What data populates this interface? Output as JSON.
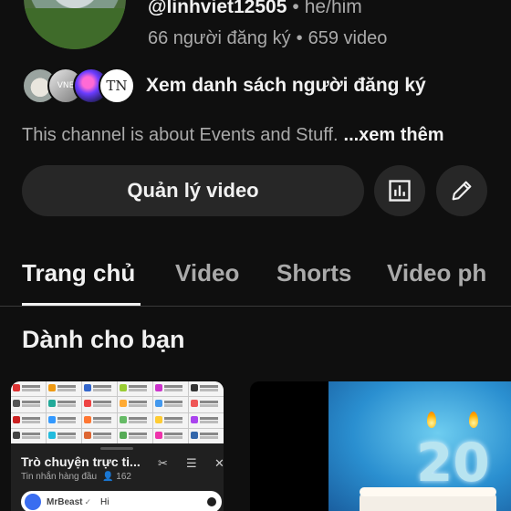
{
  "channel": {
    "handle": "@linhviet12505",
    "pronouns": "he/him",
    "subscribers": "66 người đăng ký",
    "videos": "659 video",
    "subscribers_link": "Xem danh sách người đăng ký",
    "subscriber_avatar_2_text": "VNE",
    "subscriber_avatar_4_text": "TN",
    "description": "This channel is about Events and Stuff.",
    "description_more": "...xem thêm"
  },
  "actions": {
    "manage_label": "Quản lý video",
    "stats_icon": "bar-chart-icon",
    "edit_icon": "pencil-icon"
  },
  "tabs": [
    {
      "label": "Trang chủ",
      "active": true
    },
    {
      "label": "Video",
      "active": false
    },
    {
      "label": "Shorts",
      "active": false
    },
    {
      "label": "Video ph",
      "active": false
    }
  ],
  "section": {
    "title": "Dành cho bạn"
  },
  "live_chat_thumb": {
    "title": "Trò chuyện trực ti...",
    "subtitle": "Tin nhắn hàng đầu",
    "viewer_count": "162",
    "message_author": "MrBeast",
    "message_text": "Hi"
  },
  "birthday_thumb": {
    "number": "20"
  },
  "colors": {
    "background": "#0f0f0f",
    "button_bg": "#272727",
    "text_primary": "#f1f1f1",
    "text_secondary": "#aaaaaa"
  }
}
